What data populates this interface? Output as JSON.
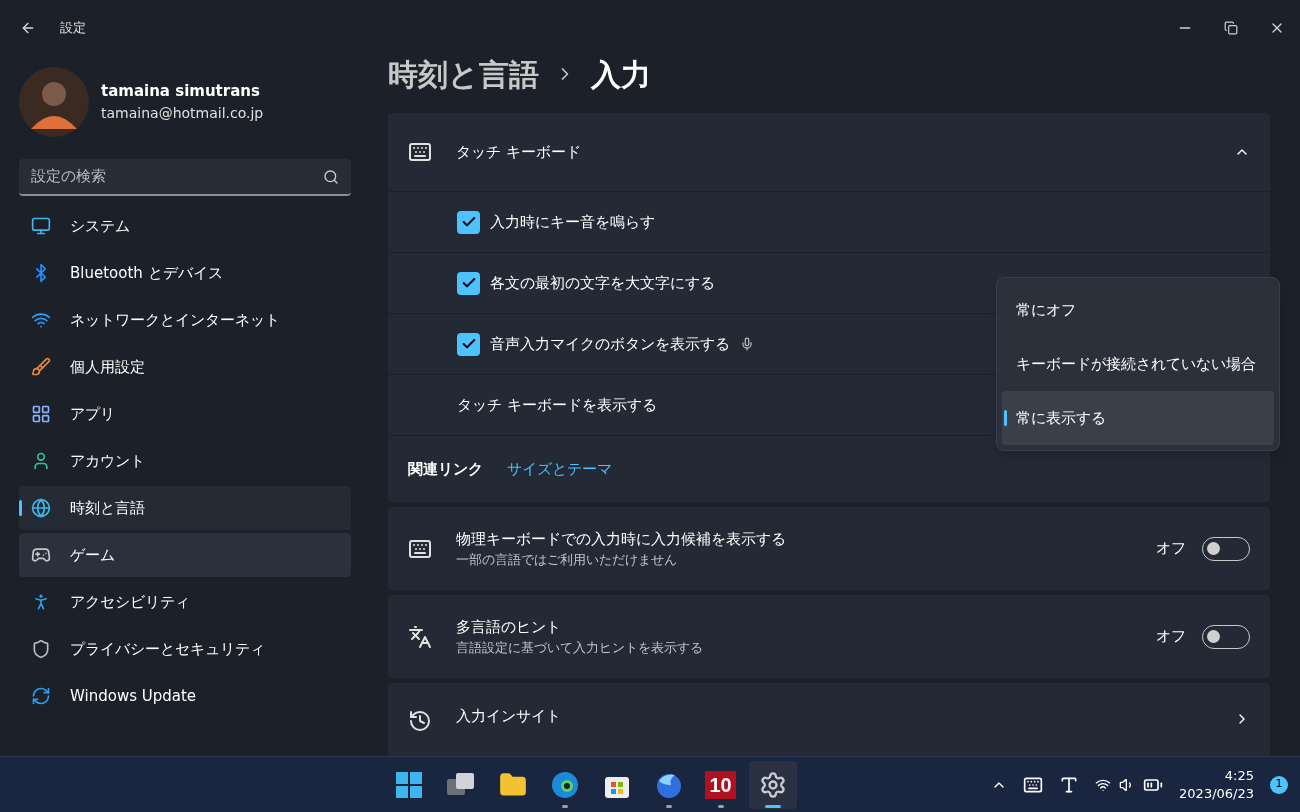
{
  "window": {
    "title": "設定"
  },
  "account": {
    "name": "tamaina simutrans",
    "email": "tamaina@hotmail.co.jp"
  },
  "search": {
    "placeholder": "設定の検索"
  },
  "sidebar": {
    "items": [
      {
        "kind": "system",
        "label": "システム",
        "selected": false,
        "hovered": false
      },
      {
        "kind": "bluetooth",
        "label": "Bluetooth とデバイス",
        "selected": false,
        "hovered": false
      },
      {
        "kind": "network",
        "label": "ネットワークとインターネット",
        "selected": false,
        "hovered": false
      },
      {
        "kind": "personalize",
        "label": "個人用設定",
        "selected": false,
        "hovered": false
      },
      {
        "kind": "apps",
        "label": "アプリ",
        "selected": false,
        "hovered": false
      },
      {
        "kind": "account",
        "label": "アカウント",
        "selected": false,
        "hovered": false
      },
      {
        "kind": "time",
        "label": "時刻と言語",
        "selected": true,
        "hovered": false
      },
      {
        "kind": "game",
        "label": "ゲーム",
        "selected": false,
        "hovered": true
      },
      {
        "kind": "access",
        "label": "アクセシビリティ",
        "selected": false,
        "hovered": false
      },
      {
        "kind": "privacy",
        "label": "プライバシーとセキュリティ",
        "selected": false,
        "hovered": false
      },
      {
        "kind": "update",
        "label": "Windows Update",
        "selected": false,
        "hovered": false
      }
    ]
  },
  "breadcrumb": {
    "parent": "時刻と言語",
    "current": "入力"
  },
  "touch_keyboard": {
    "title": "タッチ キーボード",
    "expanded": true,
    "options": [
      {
        "kind": "checkbox",
        "label": "入力時にキー音を鳴らす",
        "checked": true,
        "mic": false
      },
      {
        "kind": "checkbox",
        "label": "各文の最初の文字を大文字にする",
        "checked": true,
        "mic": false
      },
      {
        "kind": "checkbox",
        "label": "音声入力マイクのボタンを表示する",
        "checked": true,
        "mic": true
      },
      {
        "kind": "dropdown",
        "label": "タッチ キーボードを表示する"
      }
    ]
  },
  "related_links": {
    "label": "関連リンク",
    "links": [
      "サイズとテーマ"
    ]
  },
  "settings": [
    {
      "kind": "keyboard",
      "title": "物理キーボードでの入力時に入力候補を表示する",
      "subtitle": "一部の言語ではご利用いただけません",
      "state_label": "オフ",
      "on": false
    },
    {
      "kind": "language",
      "title": "多言語のヒント",
      "subtitle": "言語設定に基づいて入力ヒントを表示する",
      "state_label": "オフ",
      "on": false
    }
  ],
  "insights": {
    "title": "入力インサイト"
  },
  "dropdown_menu": {
    "options": [
      {
        "label": "常にオフ",
        "selected": false
      },
      {
        "label": "キーボードが接続されていない場合",
        "selected": false
      },
      {
        "label": "常に表示する",
        "selected": true
      }
    ]
  },
  "taskbar": {
    "apps": [
      {
        "kind": "start",
        "running": false,
        "selected": false
      },
      {
        "kind": "taskview",
        "running": false,
        "selected": false
      },
      {
        "kind": "explorer",
        "running": false,
        "selected": false
      },
      {
        "kind": "edge",
        "running": true,
        "selected": false
      },
      {
        "kind": "store",
        "running": false,
        "selected": false
      },
      {
        "kind": "firefox",
        "running": true,
        "selected": false
      },
      {
        "kind": "ten",
        "label": "10",
        "running": true,
        "selected": false
      },
      {
        "kind": "settings",
        "running": true,
        "selected": true
      }
    ],
    "time": "4:25",
    "date": "2023/06/23",
    "badge": "1"
  }
}
